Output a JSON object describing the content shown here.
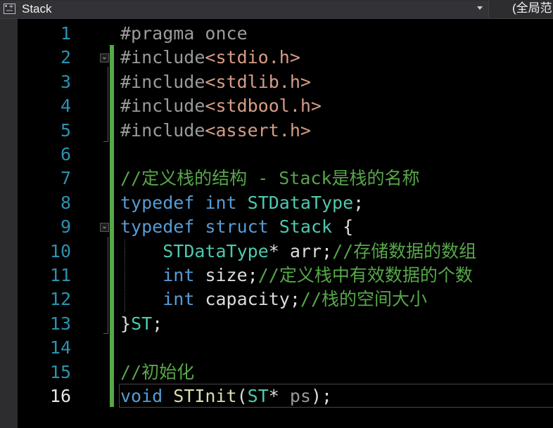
{
  "scope_bar": {
    "file_label": "Stack",
    "scope_right": "(全局范"
  },
  "editor": {
    "current_line": 16,
    "lines": [
      {
        "num": "1",
        "tokens": [
          {
            "t": "#pragma once",
            "c": "t-pre"
          }
        ]
      },
      {
        "num": "2",
        "tokens": [
          {
            "t": "#include",
            "c": "t-pre"
          },
          {
            "t": "<stdio.h>",
            "c": "t-str"
          }
        ]
      },
      {
        "num": "3",
        "tokens": [
          {
            "t": "#include",
            "c": "t-pre"
          },
          {
            "t": "<stdlib.h>",
            "c": "t-str"
          }
        ]
      },
      {
        "num": "4",
        "tokens": [
          {
            "t": "#include",
            "c": "t-pre"
          },
          {
            "t": "<stdbool.h>",
            "c": "t-str"
          }
        ]
      },
      {
        "num": "5",
        "tokens": [
          {
            "t": "#include",
            "c": "t-pre"
          },
          {
            "t": "<assert.h>",
            "c": "t-str"
          }
        ]
      },
      {
        "num": "6",
        "tokens": []
      },
      {
        "num": "7",
        "tokens": [
          {
            "t": "//定义栈的结构 - Stack是栈的名称",
            "c": "t-com"
          }
        ]
      },
      {
        "num": "8",
        "tokens": [
          {
            "t": "typedef",
            "c": "t-kw"
          },
          {
            "t": " ",
            "c": "t-punc"
          },
          {
            "t": "int",
            "c": "t-kw"
          },
          {
            "t": " ",
            "c": "t-punc"
          },
          {
            "t": "STDataType",
            "c": "t-type"
          },
          {
            "t": ";",
            "c": "t-punc"
          }
        ]
      },
      {
        "num": "9",
        "tokens": [
          {
            "t": "typedef",
            "c": "t-kw"
          },
          {
            "t": " ",
            "c": "t-punc"
          },
          {
            "t": "struct",
            "c": "t-kw"
          },
          {
            "t": " ",
            "c": "t-punc"
          },
          {
            "t": "Stack",
            "c": "t-type"
          },
          {
            "t": " {",
            "c": "t-punc"
          }
        ]
      },
      {
        "num": "10",
        "tokens": [
          {
            "t": "    ",
            "c": "t-punc"
          },
          {
            "t": "STDataType",
            "c": "t-type"
          },
          {
            "t": "* ",
            "c": "t-punc"
          },
          {
            "t": "arr",
            "c": "t-id"
          },
          {
            "t": ";",
            "c": "t-punc"
          },
          {
            "t": "//存储数据的数组",
            "c": "t-com"
          }
        ]
      },
      {
        "num": "11",
        "tokens": [
          {
            "t": "    ",
            "c": "t-punc"
          },
          {
            "t": "int",
            "c": "t-kw"
          },
          {
            "t": " ",
            "c": "t-punc"
          },
          {
            "t": "size",
            "c": "t-id"
          },
          {
            "t": ";",
            "c": "t-punc"
          },
          {
            "t": "//定义栈中有效数据的个数",
            "c": "t-com"
          }
        ]
      },
      {
        "num": "12",
        "tokens": [
          {
            "t": "    ",
            "c": "t-punc"
          },
          {
            "t": "int",
            "c": "t-kw"
          },
          {
            "t": " ",
            "c": "t-punc"
          },
          {
            "t": "capacity",
            "c": "t-id"
          },
          {
            "t": ";",
            "c": "t-punc"
          },
          {
            "t": "//栈的空间大小",
            "c": "t-com"
          }
        ]
      },
      {
        "num": "13",
        "tokens": [
          {
            "t": "}",
            "c": "t-punc"
          },
          {
            "t": "ST",
            "c": "t-type"
          },
          {
            "t": ";",
            "c": "t-punc"
          }
        ]
      },
      {
        "num": "14",
        "tokens": []
      },
      {
        "num": "15",
        "tokens": [
          {
            "t": "//初始化",
            "c": "t-com"
          }
        ]
      },
      {
        "num": "16",
        "tokens": [
          {
            "t": "void",
            "c": "t-kw"
          },
          {
            "t": " ",
            "c": "t-punc"
          },
          {
            "t": "STInit",
            "c": "t-fn"
          },
          {
            "t": "(",
            "c": "t-punc"
          },
          {
            "t": "ST",
            "c": "t-type"
          },
          {
            "t": "* ",
            "c": "t-punc"
          },
          {
            "t": "ps",
            "c": "t-par"
          },
          {
            "t": ");",
            "c": "t-punc"
          }
        ]
      }
    ]
  },
  "fold_buttons": [
    {
      "line": 2,
      "symbol": "⌄",
      "icon": "collapse-include-block-icon"
    },
    {
      "line": 9,
      "symbol": "⌄",
      "icon": "collapse-struct-block-icon"
    }
  ],
  "colors": {
    "change_marker": "#57a64a",
    "line_number": "#2b91af",
    "keyword": "#569cd6",
    "type": "#4ec9b0",
    "comment": "#57a64a",
    "string": "#d69d85"
  }
}
